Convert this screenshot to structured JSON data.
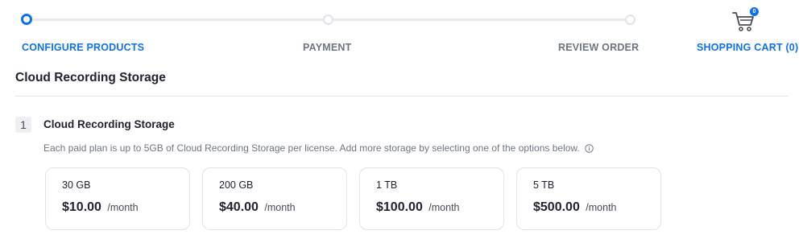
{
  "stepper": {
    "steps": [
      {
        "label": "CONFIGURE PRODUCTS",
        "state": "active"
      },
      {
        "label": "PAYMENT",
        "state": "inactive"
      },
      {
        "label": "REVIEW ORDER",
        "state": "inactive"
      }
    ],
    "cart": {
      "label": "SHOPPING CART (0)",
      "badge": "0",
      "icon": "shopping-cart-icon"
    }
  },
  "section": {
    "title": "Cloud Recording Storage"
  },
  "item": {
    "number": "1",
    "title": "Cloud Recording Storage",
    "description": "Each paid plan is up to 5GB of Cloud Recording Storage per license. Add more storage by selecting one of the options below.",
    "info_icon": "info-icon",
    "options": [
      {
        "size": "30 GB",
        "price": "$10.00",
        "period": "/month"
      },
      {
        "size": "200 GB",
        "price": "$40.00",
        "period": "/month"
      },
      {
        "size": "1 TB",
        "price": "$100.00",
        "period": "/month"
      },
      {
        "size": "5 TB",
        "price": "$500.00",
        "period": "/month"
      }
    ]
  },
  "colors": {
    "accent": "#0e72ed",
    "muted_text": "#6e7680",
    "border": "#e2e2e8"
  }
}
